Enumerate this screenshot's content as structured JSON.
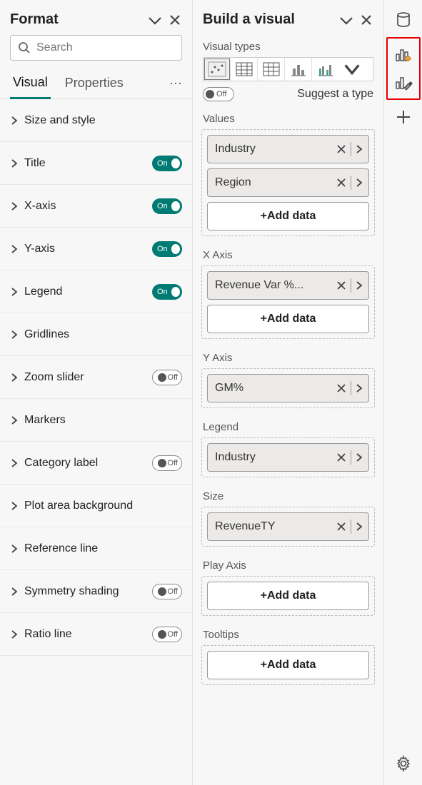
{
  "format": {
    "title": "Format",
    "search_placeholder": "Search",
    "tabs": {
      "visual": "Visual",
      "properties": "Properties"
    },
    "rows": [
      {
        "label": "Size and style",
        "toggle": null
      },
      {
        "label": "Title",
        "toggle": "on"
      },
      {
        "label": "X-axis",
        "toggle": "on"
      },
      {
        "label": "Y-axis",
        "toggle": "on"
      },
      {
        "label": "Legend",
        "toggle": "on"
      },
      {
        "label": "Gridlines",
        "toggle": null
      },
      {
        "label": "Zoom slider",
        "toggle": "off"
      },
      {
        "label": "Markers",
        "toggle": null
      },
      {
        "label": "Category label",
        "toggle": "off"
      },
      {
        "label": "Plot area background",
        "toggle": null
      },
      {
        "label": "Reference line",
        "toggle": null
      },
      {
        "label": "Symmetry shading",
        "toggle": "off"
      },
      {
        "label": "Ratio line",
        "toggle": "off"
      }
    ],
    "toggle_labels": {
      "on": "On",
      "off": "Off"
    }
  },
  "build": {
    "title": "Build a visual",
    "visual_types_label": "Visual types",
    "suggest": {
      "toggle_label": "Off",
      "text": "Suggest a type"
    },
    "add_data_label": "+Add data",
    "wells": [
      {
        "label": "Values",
        "fields": [
          "Industry",
          "Region"
        ],
        "add": true
      },
      {
        "label": "X Axis",
        "fields": [
          "Revenue Var %..."
        ],
        "add": true
      },
      {
        "label": "Y Axis",
        "fields": [
          "GM%"
        ],
        "add": false
      },
      {
        "label": "Legend",
        "fields": [
          "Industry"
        ],
        "add": false
      },
      {
        "label": "Size",
        "fields": [
          "RevenueTY"
        ],
        "add": false
      },
      {
        "label": "Play Axis",
        "fields": [],
        "add": true
      },
      {
        "label": "Tooltips",
        "fields": [],
        "add": true
      }
    ]
  }
}
